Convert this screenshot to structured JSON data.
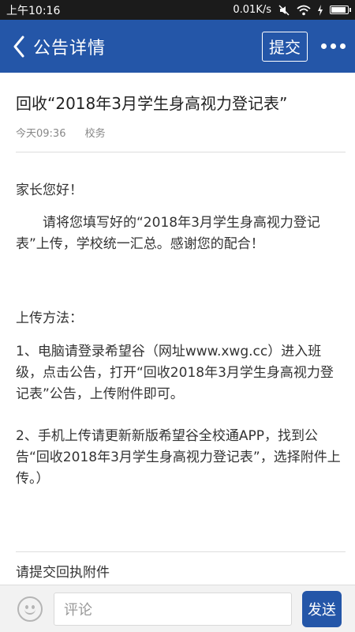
{
  "status_bar": {
    "time": "上午10:16",
    "speed": "0.01K/s"
  },
  "nav": {
    "title": "公告详情",
    "submit_label": "提交"
  },
  "article": {
    "title": "回收“2018年3月学生身高视力登记表”",
    "time": "今天09:36",
    "department": "校务",
    "greeting": "家长您好！",
    "paragraph": "请将您填写好的“2018年3月学生身高视力登记表”上传，学校统一汇总。感谢您的配合！",
    "method_heading": "上传方法：",
    "method_1": "1、电脑请登录希望谷（网址www.xwg.cc）进入班级，点击公告，打开“回收2018年3月学生身高视力登记表”公告，上传附件即可。",
    "method_2": "2、手机上传请更新新版希望谷全校通APP，找到公告“回收2018年3月学生身高视力登记表”，选择附件上传。）",
    "attachment_heading": "请提交回执附件"
  },
  "bottom_bar": {
    "comment_placeholder": "评论",
    "send_label": "发送"
  }
}
